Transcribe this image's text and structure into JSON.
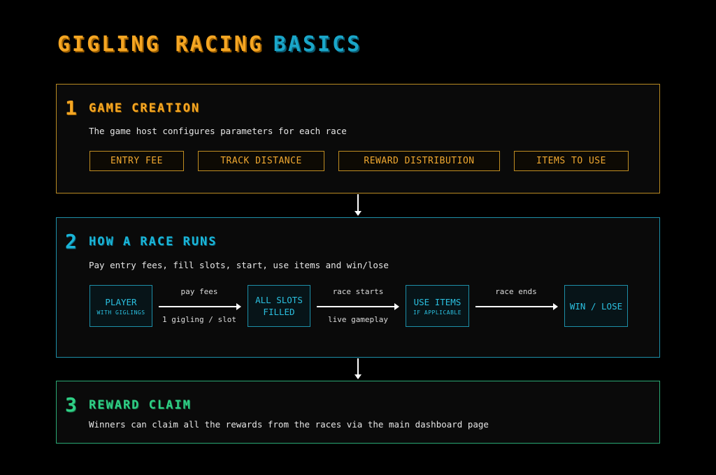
{
  "title": {
    "part1": "GIGLING RACING",
    "part2": "BASICS"
  },
  "sections": [
    {
      "number": "1",
      "title": "GAME CREATION",
      "description": "The game host configures parameters for each race",
      "params": [
        "ENTRY FEE",
        "TRACK DISTANCE",
        "REWARD DISTRIBUTION",
        "ITEMS TO USE"
      ]
    },
    {
      "number": "2",
      "title": "HOW A RACE RUNS",
      "description": "Pay entry fees, fill slots, start, use items and win/lose",
      "steps": [
        {
          "label": "PLAYER",
          "sub": "WITH GIGLINGS"
        },
        {
          "label": "ALL SLOTS",
          "label2": "FILLED"
        },
        {
          "label": "USE ITEMS",
          "sub": "IF APPLICABLE"
        },
        {
          "label": "WIN / LOSE"
        }
      ],
      "arrows": [
        {
          "above": "pay fees",
          "below": "1 gigling / slot"
        },
        {
          "above": "race starts",
          "below": "live gameplay"
        },
        {
          "above": "race ends"
        }
      ]
    },
    {
      "number": "3",
      "title": "REWARD CLAIM",
      "description": "Winners can claim all the rewards from the races via the main dashboard page"
    }
  ],
  "colors": {
    "section1": "#f5a623",
    "section2": "#1ab5d8",
    "section3": "#2fcf85",
    "background": "#000000"
  }
}
